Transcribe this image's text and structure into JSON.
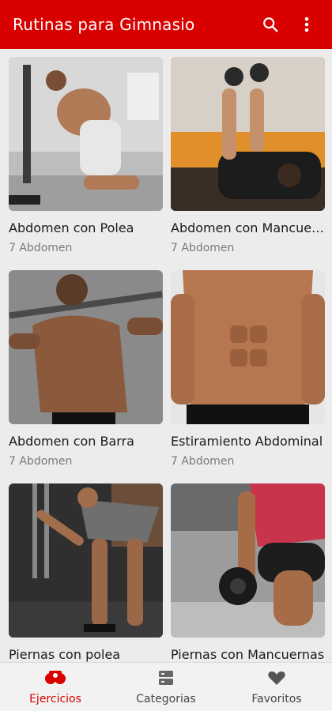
{
  "appbar": {
    "title": "Rutinas para Gimnasio",
    "search_icon": "search-icon",
    "menu_icon": "more-vert-icon"
  },
  "exercises": [
    {
      "title": "Abdomen con Polea",
      "subtitle": "7 Abdomen"
    },
    {
      "title": "Abdomen con Mancuernas",
      "subtitle": "7 Abdomen"
    },
    {
      "title": "Abdomen con Barra",
      "subtitle": "7 Abdomen"
    },
    {
      "title": "Estiramiento Abdominal",
      "subtitle": "7 Abdomen"
    },
    {
      "title": "Piernas con polea",
      "subtitle": ""
    },
    {
      "title": "Piernas con Mancuernas",
      "subtitle": ""
    }
  ],
  "bottom_nav": [
    {
      "label": "Ejercicios",
      "icon": "dumbbell-icon",
      "active": true
    },
    {
      "label": "Categorias",
      "icon": "categories-icon",
      "active": false
    },
    {
      "label": "Favoritos",
      "icon": "heart-icon",
      "active": false
    }
  ],
  "colors": {
    "accent": "#d90000",
    "background": "#ececec"
  }
}
